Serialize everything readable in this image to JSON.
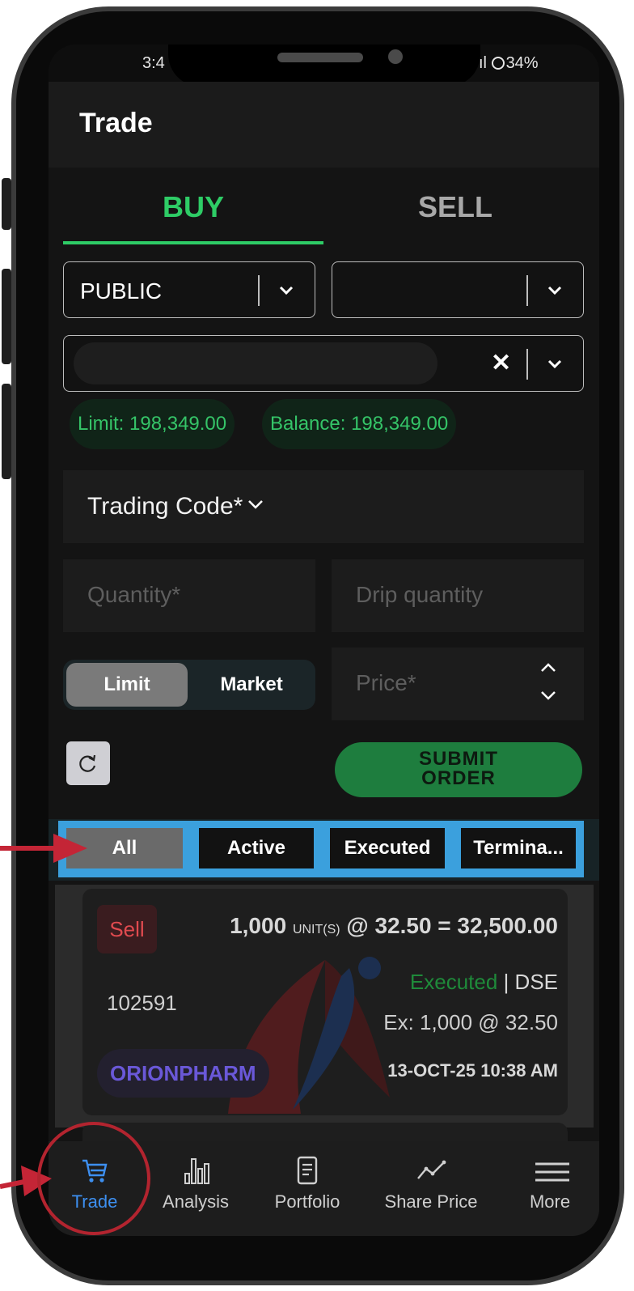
{
  "status_bar": {
    "time": "3:4",
    "signal": "ıl",
    "battery": "34%"
  },
  "header": {
    "title": "Trade"
  },
  "tabs": {
    "buy": "BUY",
    "sell": "SELL"
  },
  "account_select": {
    "value": "PUBLIC"
  },
  "counts": {
    "limit": "Limit: 198,349.00",
    "balance": "Balance: 198,349.00"
  },
  "form": {
    "trading_code_label": "Trading Code*",
    "quantity_placeholder": "Quantity*",
    "drip_placeholder": "Drip quantity",
    "price_placeholder": "Price*",
    "order_type_limit": "Limit",
    "order_type_market": "Market",
    "submit_line1": "SUBMIT",
    "submit_line2": "ORDER"
  },
  "filters": [
    "All",
    "Active",
    "Executed",
    "Termina..."
  ],
  "orders": [
    {
      "side": "Sell",
      "quantity": "1,000",
      "unit": "UNIT(S)",
      "price_expr": "@ 32.50 = 32,500.00",
      "id": "102591",
      "status": "Executed",
      "exchange": "| DSE",
      "executed": "Ex: 1,000 @ 32.50",
      "symbol": "ORIONPHARM",
      "datetime": "13-OCT-25 10:38 AM"
    }
  ],
  "bottom_nav": [
    {
      "label": "Trade",
      "icon": "cart-icon",
      "active": true
    },
    {
      "label": "Analysis",
      "icon": "bar-chart-icon",
      "active": false
    },
    {
      "label": "Portfolio",
      "icon": "document-icon",
      "active": false
    },
    {
      "label": "Share Price",
      "icon": "line-chart-icon",
      "active": false
    },
    {
      "label": "More",
      "icon": "menu-icon",
      "active": false
    }
  ],
  "colors": {
    "buy_green": "#2ecc66",
    "sell_red": "#e04a4f",
    "highlight_blue": "#3ba0dd",
    "annotation_red": "#b3242f",
    "active_nav_blue": "#3d8ff0"
  }
}
